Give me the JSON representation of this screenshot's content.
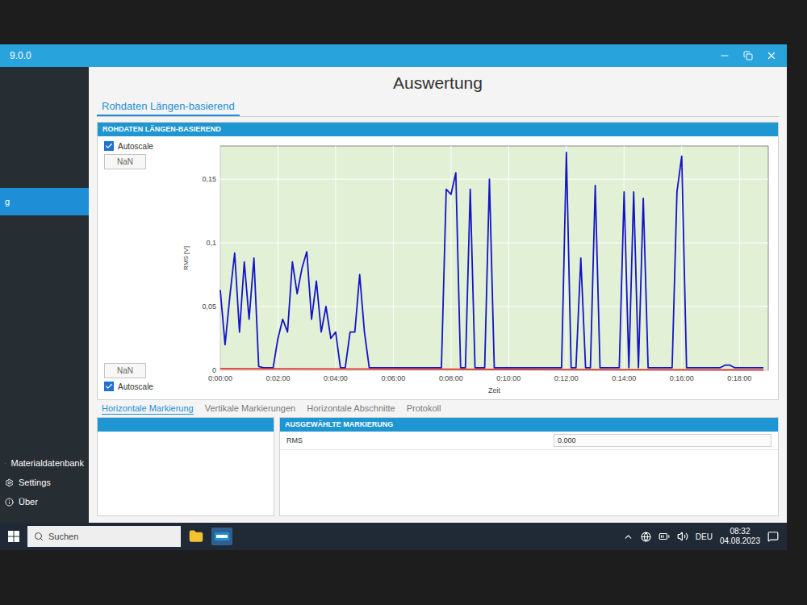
{
  "window": {
    "title": "9.0.0"
  },
  "sidebar": {
    "items": [
      {
        "label": "g",
        "selected": true
      },
      {
        "label": "Materialdatenbank",
        "selected": false
      },
      {
        "label": "Settings",
        "selected": false
      },
      {
        "label": "Über",
        "selected": false
      }
    ]
  },
  "page": {
    "title": "Auswertung"
  },
  "tabs": [
    {
      "label": "Rohdaten Längen-basierend",
      "selected": true
    }
  ],
  "panel": {
    "title": "ROHDATEN LÄNGEN-BASIEREND"
  },
  "chart": {
    "y_autoscale": {
      "label": "Autoscale",
      "checked": true
    },
    "y_field": "NaN",
    "x_field": "NaN",
    "x_autoscale": {
      "label": "Autoscale",
      "checked": true
    },
    "y_axis_label": "RMS [V]",
    "x_axis_label": "Zeit",
    "y_ticks": [
      {
        "label": "0",
        "value": 0
      },
      {
        "label": "0,05",
        "value": 0.05
      },
      {
        "label": "0,1",
        "value": 0.1
      },
      {
        "label": "0,15",
        "value": 0.15
      }
    ],
    "x_ticks": [
      "0:00:00",
      "0:02:00",
      "0:04:00",
      "0:06:00",
      "0:08:00",
      "0:10:00",
      "0:12:00",
      "0:14:00",
      "0:16:00",
      "0:18:00"
    ],
    "series": [
      {
        "color": "#1414c8",
        "values": [
          0.063,
          0.02,
          0.058,
          0.092,
          0.03,
          0.085,
          0.04,
          0.088,
          0.003,
          0.002,
          0.002,
          0.002,
          0.025,
          0.04,
          0.03,
          0.085,
          0.06,
          0.08,
          0.093,
          0.04,
          0.07,
          0.03,
          0.05,
          0.025,
          0.03,
          0.002,
          0.002,
          0.03,
          0.03,
          0.075,
          0.03,
          0.002,
          0.002,
          0.002,
          0.002,
          0.002,
          0.002,
          0.002,
          0.002,
          0.002,
          0.002,
          0.002,
          0.002,
          0.002,
          0.002,
          0.002,
          0.002,
          0.142,
          0.138,
          0.155,
          0.002,
          0.002,
          0.142,
          0.002,
          0.002,
          0.002,
          0.15,
          0.002,
          0.002,
          0.002,
          0.002,
          0.002,
          0.002,
          0.002,
          0.002,
          0.002,
          0.002,
          0.002,
          0.002,
          0.002,
          0.002,
          0.002,
          0.171,
          0.002,
          0.002,
          0.088,
          0.002,
          0.002,
          0.145,
          0.002,
          0.002,
          0.002,
          0.002,
          0.002,
          0.14,
          0.002,
          0.14,
          0.002,
          0.135,
          0.002,
          0.002,
          0.002,
          0.002,
          0.002,
          0.002,
          0.14,
          0.168,
          0.002,
          0.002,
          0.002,
          0.002,
          0.002,
          0.002,
          0.002,
          0.002,
          0.004,
          0.004,
          0.002,
          0.002,
          0.002,
          0.002,
          0.002,
          0.002,
          0.002
        ]
      },
      {
        "color": "#e03020",
        "values": [
          0.0012,
          0.001,
          0.0008,
          0.0006,
          0.0004,
          0.0002
        ]
      }
    ]
  },
  "subtabs": [
    {
      "label": "Horizontale Markierung",
      "selected": true
    },
    {
      "label": "Vertikale Markierungen",
      "selected": false
    },
    {
      "label": "Horizontale Abschnitte",
      "selected": false
    },
    {
      "label": "Protokoll",
      "selected": false
    }
  ],
  "selected_marking": {
    "title": "AUSGEWÄHLTE MARKIERUNG",
    "rows": [
      {
        "label": "RMS",
        "value": "0.000"
      }
    ]
  },
  "taskbar": {
    "search_placeholder": "Suchen",
    "language": "DEU",
    "time": "08:32",
    "date": "04.08.2023"
  }
}
